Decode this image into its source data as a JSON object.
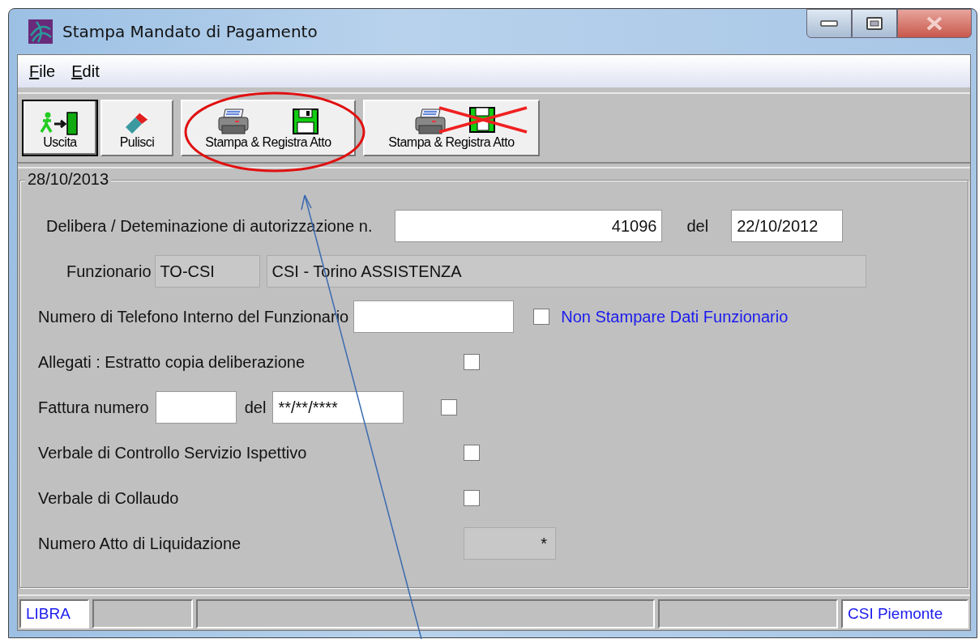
{
  "window": {
    "title": "Stampa Mandato di Pagamento"
  },
  "menu": [
    {
      "label": "File"
    },
    {
      "label": "Edit"
    }
  ],
  "toolbar": [
    {
      "kind": "exit",
      "label": "Uscita",
      "focused": true
    },
    {
      "kind": "eraser",
      "label": "Pulisci",
      "focused": false
    },
    {
      "kind": "print_save",
      "label": "Stampa & Registra Atto",
      "focused": false
    },
    {
      "kind": "print_nosave",
      "label": "Stampa & Registra Atto",
      "focused": false
    }
  ],
  "form": {
    "legend": "28/10/2013",
    "rows": [
      {
        "kind": "delibera",
        "label": "Delibera / Deteminazione di autorizzazione n.",
        "number": "41096",
        "date_label": "del",
        "date": "22/10/2012"
      },
      {
        "kind": "funzionario",
        "label": "Funzionario",
        "code": "TO-CSI",
        "name": "CSI - Torino ASSISTENZA"
      },
      {
        "kind": "telefono",
        "label": "Numero di Telefono Interno del Funzionario",
        "option": "Non Stampare Dati Funzionario",
        "checked": false
      },
      {
        "kind": "check",
        "label": "Allegati : Estratto copia deliberazione",
        "checked": false
      },
      {
        "kind": "fattura",
        "label": "Fattura numero",
        "date_label": "del",
        "date": "**/**/****",
        "checked": false
      },
      {
        "kind": "check",
        "label": "Verbale di Controllo Servizio Ispettivo",
        "checked": false
      },
      {
        "kind": "check",
        "label": "Verbale di Collaudo",
        "checked": false
      },
      {
        "kind": "readonly",
        "label": "Numero Atto di Liquidazione",
        "value": "*"
      }
    ]
  },
  "status_bar": {
    "left": "LIBRA",
    "right": "CSI Piemonte"
  },
  "annotations": [
    {
      "kind": "ellipse"
    },
    {
      "kind": "arrow"
    }
  ]
}
